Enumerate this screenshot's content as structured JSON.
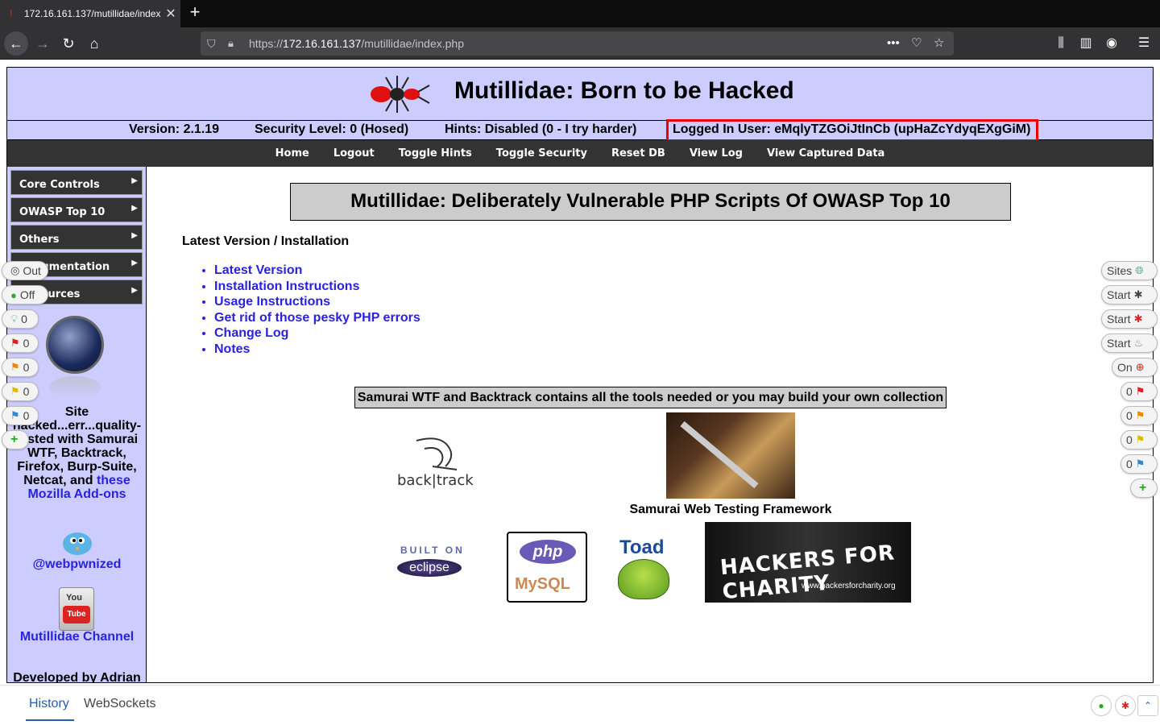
{
  "browser": {
    "tab_title": "172.16.161.137/mutillidae/index",
    "url_prefix": "https://",
    "url_host": "172.16.161.137",
    "url_path": "/mutillidae/index.php"
  },
  "header": {
    "title": "Mutillidae: Born to be Hacked",
    "version": "Version: 2.1.19",
    "security": "Security Level: 0 (Hosed)",
    "hints": "Hints: Disabled (0 - I try harder)",
    "logged_in": "Logged In User: eMqlyTZGOiJtInCb (upHaZcYdyqEXgGiM)"
  },
  "menu": [
    "Home",
    "Logout",
    "Toggle Hints",
    "Toggle Security",
    "Reset DB",
    "View Log",
    "View Captured Data"
  ],
  "sidebar": {
    "items": [
      "Core Controls",
      "OWASP Top 10",
      "Others",
      "Documentation",
      "Resources"
    ],
    "text_plain": "Site hacked...err...quality-tested with Samurai WTF, Backtrack, Firefox, Burp-Suite, Netcat, and",
    "text_link": "these Mozilla Add-ons",
    "twitter": "@webpwnized",
    "youtube": "Mutillidae Channel",
    "youtube_you": "You",
    "youtube_tube": "Tube",
    "developed": "Developed by Adrian"
  },
  "main": {
    "title": "Mutillidae: Deliberately Vulnerable PHP Scripts Of OWASP Top 10",
    "subhead": "Latest Version / Installation",
    "links": [
      "Latest Version",
      "Installation Instructions",
      "Usage Instructions",
      "Get rid of those pesky PHP errors",
      "Change Log",
      "Notes"
    ],
    "samurai_box": "Samurai WTF and Backtrack contains all the tools needed or you may build your own collection",
    "backtrack_text": "back|track",
    "samurai_caption": "Samurai Web Testing Framework",
    "eclipse_built": "BUILT ON",
    "eclipse_name": "eclipse",
    "php": "php",
    "mysql": "MySQL",
    "toad": "Toad",
    "hfc": "HACKERS FOR CHARITY",
    "hfc_url": "www.hackersforcharity.org"
  },
  "widgets_left": [
    "Out",
    "Off",
    "0",
    "0",
    "0",
    "0",
    "0"
  ],
  "widgets_right": [
    "Sites",
    "Start",
    "Start",
    "Start",
    "On",
    "0",
    "0",
    "0",
    "0"
  ],
  "bottom": {
    "tabs": [
      "History",
      "WebSockets"
    ]
  },
  "colors": {
    "header_bg": "#ccccff",
    "menu_bg": "#333333",
    "link": "#2a22dd",
    "highlight_border": "#ee0000"
  }
}
